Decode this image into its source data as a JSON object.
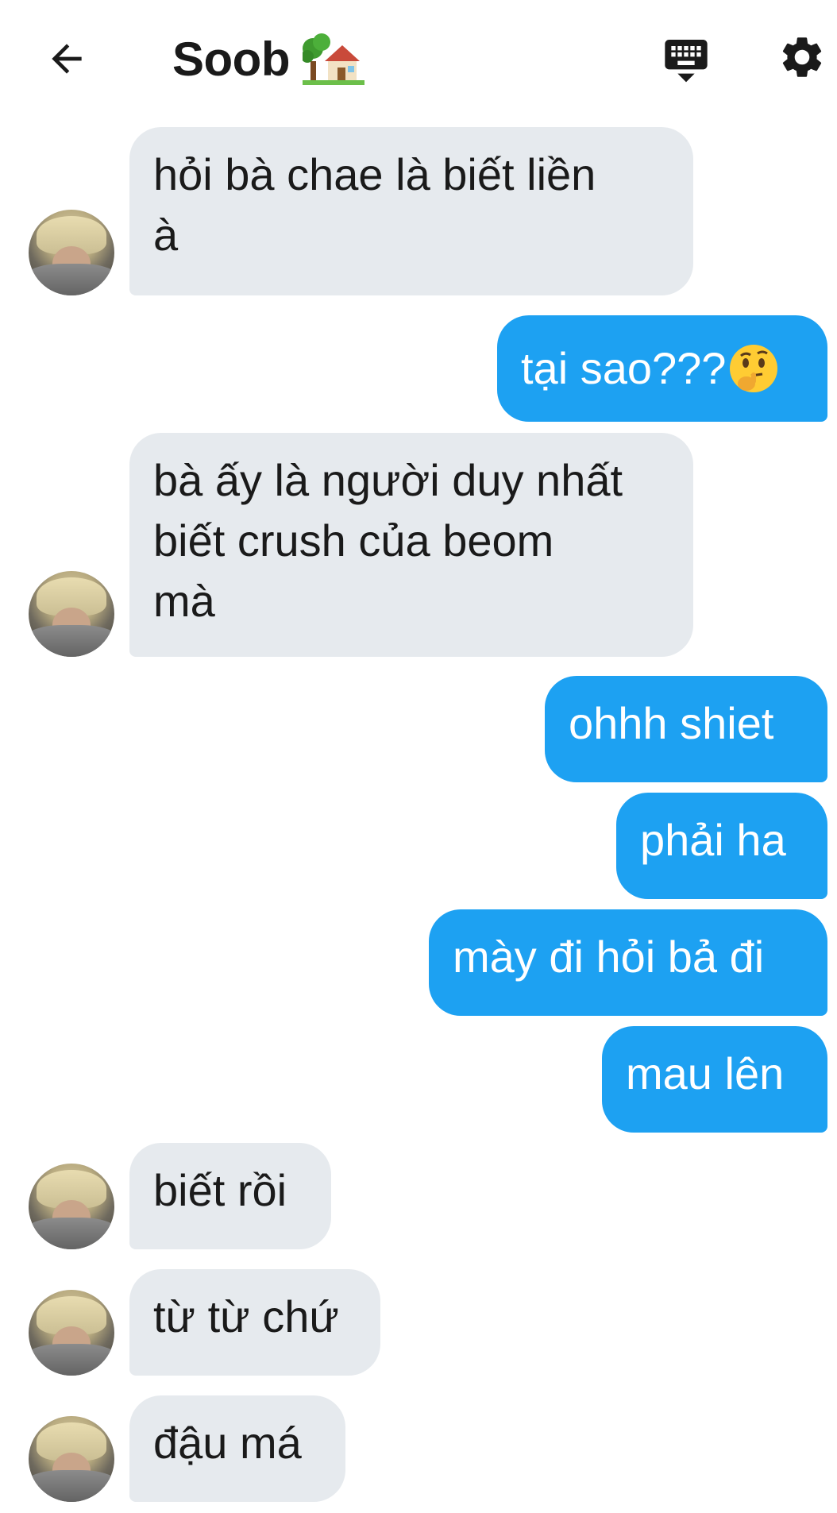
{
  "header": {
    "title": "Soob",
    "back_icon": "arrow-left-icon",
    "keyboard_icon": "keyboard-icon",
    "settings_icon": "gear-icon"
  },
  "messages": [
    {
      "side": "in",
      "text": "hỏi bà chae là biết liền\nà",
      "avatar": true
    },
    {
      "side": "out",
      "text": "tại sao???"
    },
    {
      "side": "in",
      "text": "bà ấy là người duy nhất\nbiết crush của beom\nmà",
      "avatar": true
    },
    {
      "side": "out",
      "text": "ohhh shiet"
    },
    {
      "side": "out",
      "text": "phải ha"
    },
    {
      "side": "out",
      "text": "mày đi hỏi bả đi"
    },
    {
      "side": "out",
      "text": "mau lên"
    },
    {
      "side": "in",
      "text": "biết rồi",
      "avatar": true
    },
    {
      "side": "in",
      "text": "từ từ chứ",
      "avatar": true
    },
    {
      "side": "in",
      "text": "đậu má",
      "avatar": true
    }
  ],
  "colors": {
    "outgoing_bubble": "#1da1f2",
    "incoming_bubble": "#e6eaee",
    "text_dark": "#1a1a1a"
  }
}
